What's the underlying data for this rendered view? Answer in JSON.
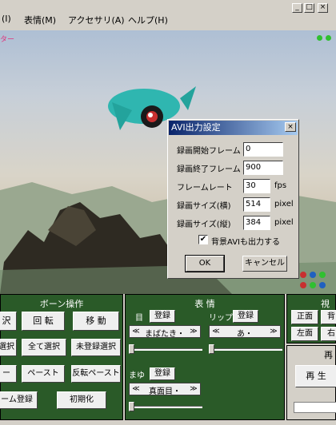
{
  "menu": {
    "items": [
      "(I)",
      "表情(M)",
      "アクセサリ(A)",
      "ヘルプ(H)"
    ]
  },
  "window_controls": {
    "minimize": "_",
    "maximize": "□",
    "close": "×"
  },
  "viewport": {
    "corner_label": "ター"
  },
  "dialog": {
    "title": "AVI出力設定",
    "close": "×",
    "fields": [
      {
        "label": "録画開始フレーム",
        "value": "0",
        "unit": ""
      },
      {
        "label": "録画終了フレーム",
        "value": "900",
        "unit": ""
      },
      {
        "label": "フレームレート",
        "value": "30",
        "unit": "fps"
      },
      {
        "label": "録画サイズ(横)",
        "value": "514",
        "unit": "pixel"
      },
      {
        "label": "録画サイズ(縦)",
        "value": "384",
        "unit": "pixel"
      }
    ],
    "checkbox_label": "背景AVIも出力する",
    "checkbox_checked": true,
    "checkbox_mark": "✔",
    "ok": "OK",
    "cancel": "キャンセル"
  },
  "bone_panel": {
    "title": "ボーン操作",
    "buttons": [
      "沢",
      "回 転",
      "移 動",
      "選択",
      "全て選択",
      "未登録選択",
      "ー",
      "ペースト",
      "反転ペースト",
      "ーム登録",
      "初期化"
    ]
  },
  "expression_panel": {
    "title": "表 情",
    "eye_label": "目",
    "lip_label": "リップ",
    "brow_label": "まゆ",
    "register": "登録",
    "eye_value": "まばたき・",
    "lip_value": "あ・",
    "brow_value": "真面目・",
    "arrow_left": "≪",
    "arrow_right": "≫"
  },
  "view_panel": {
    "title": "視",
    "buttons": [
      "正面",
      "背",
      "左面",
      "右"
    ]
  },
  "play_panel": {
    "title": "再",
    "play": "再 生"
  }
}
